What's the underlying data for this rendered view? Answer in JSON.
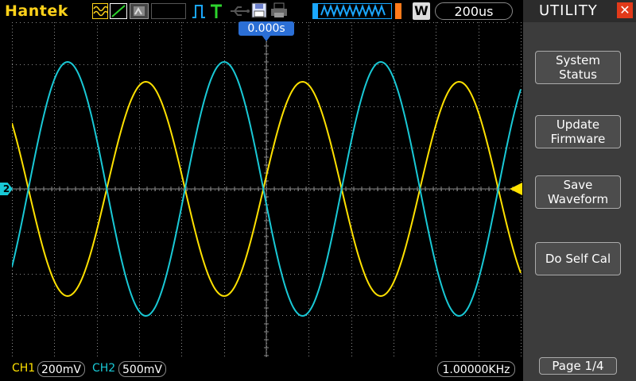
{
  "top_bar": {
    "brand": "Hantek",
    "timebase": "200us",
    "w_label": "W"
  },
  "screen": {
    "trigger_position": "0.000s",
    "ch2_marker": "2"
  },
  "bottom_bar": {
    "ch1_label": "CH1",
    "ch1_scale": "200mV",
    "ch2_label": "CH2",
    "ch2_scale": "500mV",
    "frequency": "1.00000KHz"
  },
  "menu": {
    "title": "UTILITY",
    "items": [
      {
        "line1": "System",
        "line2": "Status"
      },
      {
        "line1": "Update",
        "line2": "Firmware"
      },
      {
        "line1": "Save",
        "line2": "Waveform"
      },
      {
        "line1": "Do Self Cal",
        "line2": ""
      }
    ],
    "page": "Page 1/4"
  },
  "colors": {
    "ch1": "#ffe100",
    "ch2": "#19c9d6",
    "grid": "#8a8a8a",
    "panel_bg": "#3c3c3c",
    "close": "#e23a1a"
  },
  "icons": [
    "wave-mode-icon",
    "line-mode-icon",
    "mono-mode-icon",
    "trigger-edge-icon",
    "trigger-t-icon",
    "usb-icon",
    "save-disk-icon",
    "printer-icon",
    "run-waveform-icon",
    "close-icon"
  ]
}
